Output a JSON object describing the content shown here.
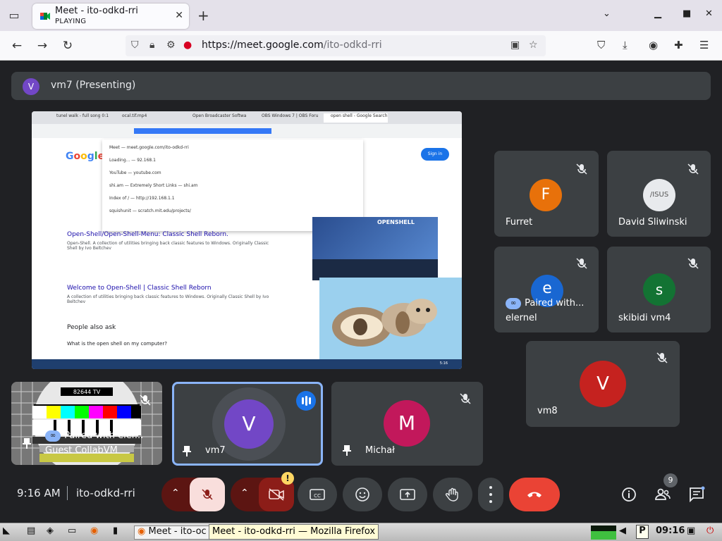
{
  "browser": {
    "tab_title": "Meet - ito-odkd-rri",
    "tab_status": "PLAYING",
    "url_domain": "https://meet.google.com",
    "url_path": "/ito-odkd-rri"
  },
  "meet": {
    "presenting_initial": "V",
    "presenting_label": "vm7 (Presenting)",
    "shared_screen": {
      "tabs": [
        "tunel walk - full song 0:1",
        "ocal.tif.mp4",
        "Open Broadcaster Softwa",
        "OBS Windows 7 | OBS Foru",
        "open shell - Google Search"
      ],
      "dropdown": [
        "Meet — meet.google.com/ito-odkd-rri",
        "Loading... — 92.168.1",
        "YouTube — youtube.com",
        "shi.am — Extremely Short Links — shi.am",
        "Index of / — http://192.168.1.1",
        "squishunit — scratch.mit.edu/projects/"
      ],
      "logo": "Google",
      "sign_in": "Sign in",
      "results": [
        {
          "title": "Open-Shell/Open-Shell-Menu: Classic Shell Reborn.",
          "text": "Open-Shell. A collection of utilities bringing back classic features to Windows. Originally Classic Shell by Ivo Beltchev"
        },
        {
          "title": "Welcome to Open-Shell | Classic Shell Reborn",
          "text": "A collection of utilities bringing back classic features to Windows. Originally Classic Shell by Ivo Beltchev"
        }
      ],
      "people_also_ask": "People also ask",
      "question": "What is the open shell on my computer?",
      "image_label": "OPENSHELL"
    },
    "participants": [
      {
        "name": "Furret",
        "initial": "F",
        "color": "#e8710a"
      },
      {
        "name": "David Sliwinski",
        "initial": "",
        "color": "#e8eaed"
      },
      {
        "name": "elernel",
        "initial": "e",
        "color": "#1967d2",
        "paired": "Paired with..."
      },
      {
        "name": "skibidi vm4",
        "initial": "s",
        "color": "#137333"
      },
      {
        "name": "vm8",
        "initial": "V",
        "color": "#c5221f"
      },
      {
        "name": "Guest CollabVM",
        "paired": "Paired with eler...",
        "tv_text": "82644 TV"
      },
      {
        "name": "vm7",
        "initial": "V",
        "color": "#7247c6"
      },
      {
        "name": "Michał",
        "initial": "M",
        "color": "#c2185b"
      }
    ],
    "clock": "9:16 AM",
    "meeting_code": "ito-odkd-rri",
    "people_count": "9",
    "colors": {
      "end_call": "#ea4335",
      "muted": "#f9dedc",
      "muted_dark": "#8c1d18",
      "accent": "#8ab4f8"
    }
  },
  "os": {
    "task_label": "Meet - ito-oc",
    "tooltip": "Meet - ito-odkd-rri — Mozilla Firefox",
    "time": "09:16"
  }
}
